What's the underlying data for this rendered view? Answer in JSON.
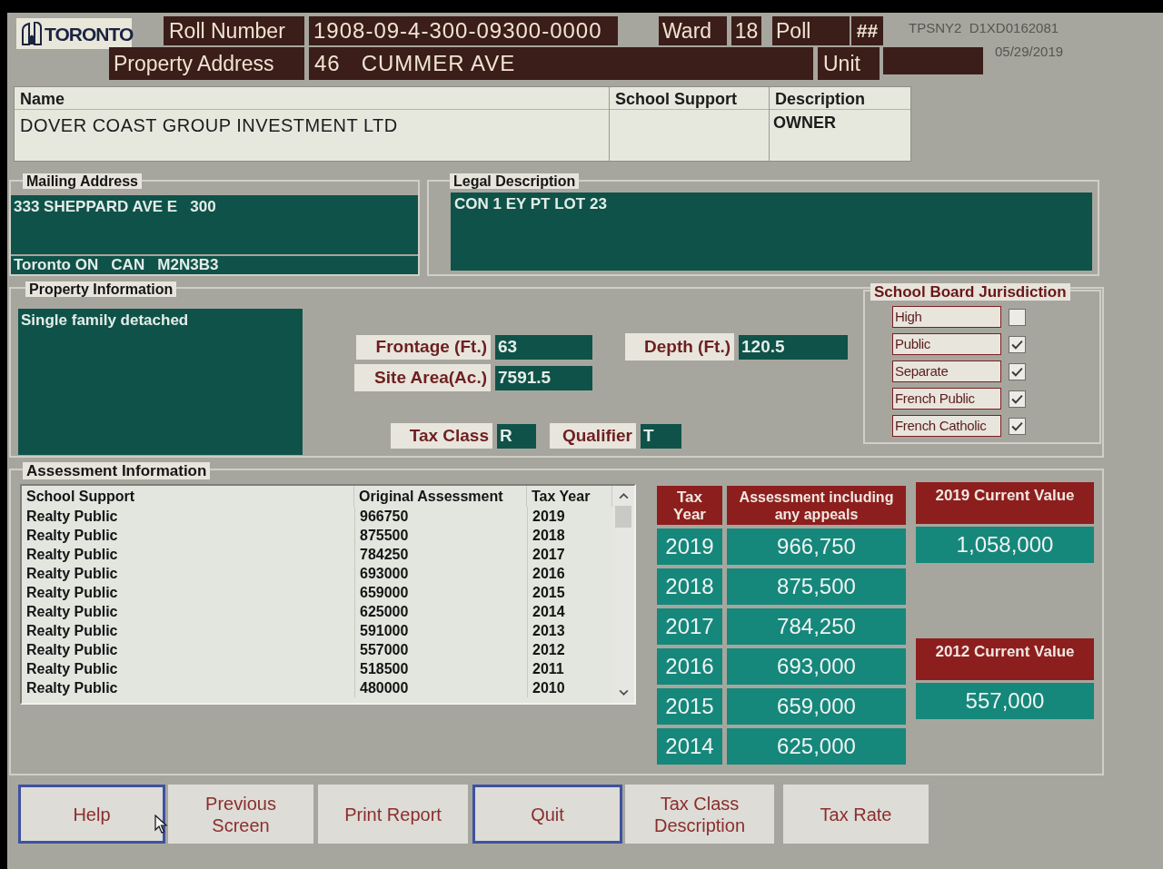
{
  "header": {
    "logo": {
      "text": "TORONTO"
    },
    "roll_number": {
      "label": "Roll Number",
      "value": "1908-09-4-300-09300-0000"
    },
    "ward": {
      "label": "Ward",
      "value": "18"
    },
    "poll": {
      "label": "Poll",
      "value": "##"
    },
    "terminal_id": "TPSNY2  D1XD0162081",
    "property_address": {
      "label": "Property Address",
      "value": "46   CUMMER AVE"
    },
    "unit": {
      "label": "Unit"
    },
    "date": "05/29/2019"
  },
  "owner": {
    "name": {
      "label": "Name",
      "value": "DOVER COAST GROUP INVESTMENT LTD"
    },
    "school_support": {
      "label": "School Support"
    },
    "description": {
      "label": "Description",
      "value": "OWNER"
    }
  },
  "mailing_address": {
    "title": "Mailing Address",
    "street": "333 SHEPPARD AVE E   300",
    "city_line": "Toronto ON   CAN   M2N3B3"
  },
  "legal_description": {
    "title": "Legal Description",
    "value": "CON 1 EY PT LOT 23"
  },
  "property_information": {
    "title": "Property Information",
    "property_type": "Single family detached",
    "frontage": {
      "label": "Frontage (Ft.)",
      "value": "63"
    },
    "site_area": {
      "label": "Site Area(Ac.)",
      "value": "7591.5"
    },
    "depth": {
      "label": "Depth (Ft.)",
      "value": "120.5"
    },
    "tax_class": {
      "label": "Tax Class",
      "value": "R"
    },
    "qualifier": {
      "label": "Qualifier",
      "value": "T"
    },
    "school_board": {
      "title": "School Board Jurisdiction",
      "options": [
        {
          "label": "High",
          "checked": false
        },
        {
          "label": "Public",
          "checked": true
        },
        {
          "label": "Separate",
          "checked": true
        },
        {
          "label": "French Public",
          "checked": true
        },
        {
          "label": "French Catholic",
          "checked": true
        }
      ]
    }
  },
  "assessment_information": {
    "title": "Assessment Information",
    "table": {
      "columns": [
        "School Support",
        "Original Assessment",
        "Tax Year"
      ],
      "rows": [
        {
          "school_support": "Realty Public",
          "original_assessment": "966750",
          "tax_year": "2019"
        },
        {
          "school_support": "Realty Public",
          "original_assessment": "875500",
          "tax_year": "2018"
        },
        {
          "school_support": "Realty Public",
          "original_assessment": "784250",
          "tax_year": "2017"
        },
        {
          "school_support": "Realty Public",
          "original_assessment": "693000",
          "tax_year": "2016"
        },
        {
          "school_support": "Realty Public",
          "original_assessment": "659000",
          "tax_year": "2015"
        },
        {
          "school_support": "Realty Public",
          "original_assessment": "625000",
          "tax_year": "2014"
        },
        {
          "school_support": "Realty Public",
          "original_assessment": "591000",
          "tax_year": "2013"
        },
        {
          "school_support": "Realty Public",
          "original_assessment": "557000",
          "tax_year": "2012"
        },
        {
          "school_support": "Realty Public",
          "original_assessment": "518500",
          "tax_year": "2011"
        },
        {
          "school_support": "Realty Public",
          "original_assessment": "480000",
          "tax_year": "2010"
        }
      ]
    },
    "summary": {
      "columns": [
        "Tax Year",
        "Assessment including any appeals"
      ],
      "rows": [
        {
          "tax_year": "2019",
          "assessment": "966,750"
        },
        {
          "tax_year": "2018",
          "assessment": "875,500"
        },
        {
          "tax_year": "2017",
          "assessment": "784,250"
        },
        {
          "tax_year": "2016",
          "assessment": "693,000"
        },
        {
          "tax_year": "2015",
          "assessment": "659,000"
        },
        {
          "tax_year": "2014",
          "assessment": "625,000"
        }
      ]
    },
    "current_values": [
      {
        "label": "2019 Current Value",
        "value": "1,058,000"
      },
      {
        "label": "2012 Current Value",
        "value": "557,000"
      }
    ]
  },
  "buttons": [
    {
      "label": "Help",
      "focused": true
    },
    {
      "label": "Previous Screen",
      "focused": false
    },
    {
      "label": "Print Report",
      "focused": false
    },
    {
      "label": "Quit",
      "focused": true
    },
    {
      "label": "Tax Class Description",
      "focused": false
    },
    {
      "label": "Tax Rate",
      "focused": false
    }
  ]
}
